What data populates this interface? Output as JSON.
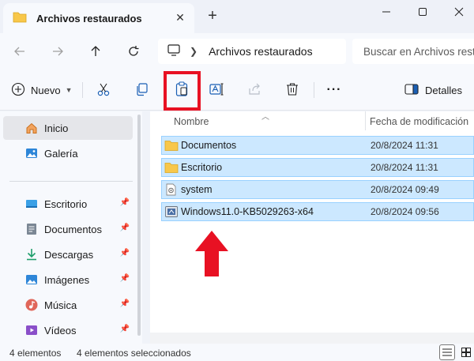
{
  "window": {
    "tab_title": "Archivos restaurados",
    "tab_close": "✕",
    "new_tab": "+"
  },
  "address": {
    "location": "Archivos restaurados",
    "search_placeholder": "Buscar en Archivos restaurados"
  },
  "toolbar": {
    "new_label": "Nuevo",
    "details_label": "Detalles",
    "more_label": "···",
    "highlighted_button": "paste"
  },
  "sidebar": {
    "items": [
      {
        "label": "Inicio",
        "icon": "home-icon",
        "pinned": false,
        "active": true
      },
      {
        "label": "Galería",
        "icon": "gallery-icon",
        "pinned": false,
        "active": false
      },
      {
        "label": "Escritorio",
        "icon": "desktop-icon",
        "pinned": true,
        "active": false
      },
      {
        "label": "Documentos",
        "icon": "documents-icon",
        "pinned": true,
        "active": false
      },
      {
        "label": "Descargas",
        "icon": "downloads-icon",
        "pinned": true,
        "active": false
      },
      {
        "label": "Imágenes",
        "icon": "pictures-icon",
        "pinned": true,
        "active": false
      },
      {
        "label": "Música",
        "icon": "music-icon",
        "pinned": true,
        "active": false
      },
      {
        "label": "Vídeos",
        "icon": "videos-icon",
        "pinned": true,
        "active": false
      }
    ]
  },
  "files": {
    "columns": {
      "name": "Nombre",
      "date": "Fecha de modificación"
    },
    "rows": [
      {
        "name": "Documentos",
        "date": "20/8/2024 11:31",
        "type": "folder",
        "selected": true
      },
      {
        "name": "Escritorio",
        "date": "20/8/2024 11:31",
        "type": "folder",
        "selected": true
      },
      {
        "name": "system",
        "date": "20/8/2024 09:49",
        "type": "system-file",
        "selected": true
      },
      {
        "name": "Windows11.0-KB5029263-x64",
        "date": "20/8/2024 09:56",
        "type": "update-file",
        "selected": true
      }
    ]
  },
  "status": {
    "item_count": "4 elementos",
    "selected_count": "4 elementos seleccionados"
  },
  "colors": {
    "selection": "#cce8ff",
    "selection_border": "#99d1ff",
    "highlight_red": "#e81123",
    "folder_yellow": "#f8c74a"
  }
}
